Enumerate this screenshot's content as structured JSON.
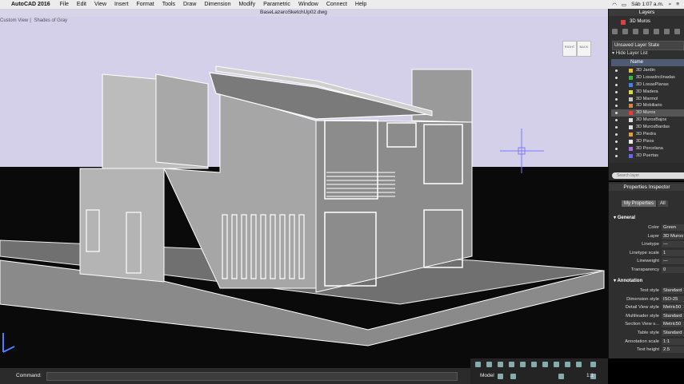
{
  "menubar": {
    "app_name": "AutoCAD 2016",
    "items": [
      "File",
      "Edit",
      "View",
      "Insert",
      "Format",
      "Tools",
      "Draw",
      "Dimension",
      "Modify",
      "Parametric",
      "Window",
      "Connect",
      "Help"
    ],
    "clock": "Sáb 1:07 a.m."
  },
  "document": {
    "title": "BaseLazaroSketchUp02.dwg"
  },
  "viewport": {
    "view_name": "Custom View",
    "visual_style": "Shades of Gray",
    "sky_color": "#d4d0ea",
    "ground_color": "#0a0a0a"
  },
  "viewcube": {
    "left_face": "RIGHT",
    "right_face": "BACK"
  },
  "command": {
    "label": "Command:",
    "value": ""
  },
  "statusbar": {
    "model_label": "Model",
    "scale": "1:1"
  },
  "layers_panel": {
    "title": "Layers",
    "current_layer": "3D Muros",
    "state_select": "Unsaved Layer State",
    "hide_list_label": "Hide Layer List",
    "column_name": "Name",
    "search_placeholder": "Search layer",
    "rows": [
      {
        "name": "3D Jardin",
        "color": "#d8c04a",
        "selected": false
      },
      {
        "name": "3D LosasInclinadas",
        "color": "#3fb24a",
        "selected": false
      },
      {
        "name": "3D LosasPlanas",
        "color": "#4a7fd8",
        "selected": false
      },
      {
        "name": "3D Madera",
        "color": "#d8d84a",
        "selected": false
      },
      {
        "name": "3D Marmol",
        "color": "#c8c8c8",
        "selected": false
      },
      {
        "name": "3D Mobiliario",
        "color": "#c88a4a",
        "selected": false
      },
      {
        "name": "3D Muros",
        "color": "#e04040",
        "selected": true
      },
      {
        "name": "3D MurosBajos",
        "color": "#dddddd",
        "selected": false
      },
      {
        "name": "3D MurosBardas",
        "color": "#dddddd",
        "selected": false
      },
      {
        "name": "3D Piedra",
        "color": "#d8a04a",
        "selected": false
      },
      {
        "name": "3D Pisos",
        "color": "#e8e8e8",
        "selected": false
      },
      {
        "name": "3D Porcelana",
        "color": "#a070d8",
        "selected": false
      },
      {
        "name": "3D Puertas",
        "color": "#6a6ad8",
        "selected": false
      }
    ]
  },
  "properties_panel": {
    "title": "Properties Inspector",
    "tabs": [
      "My Properties",
      "All"
    ],
    "general_label": "General",
    "general": [
      {
        "key": "Color",
        "value": "Green"
      },
      {
        "key": "Layer",
        "value": "3D Muros"
      },
      {
        "key": "Linetype",
        "value": "—"
      },
      {
        "key": "Linetype scale",
        "value": "1"
      },
      {
        "key": "Lineweight",
        "value": "—"
      },
      {
        "key": "Transparency",
        "value": "0"
      }
    ],
    "annotation_label": "Annotation",
    "annotation": [
      {
        "key": "Text style",
        "value": "Standard"
      },
      {
        "key": "Dimension style",
        "value": "ISO-25"
      },
      {
        "key": "Detail View style",
        "value": "Metric50"
      },
      {
        "key": "Multileader style",
        "value": "Standard"
      },
      {
        "key": "Section View s...",
        "value": "Metric50"
      },
      {
        "key": "Table style",
        "value": "Standard"
      },
      {
        "key": "Annotation scale",
        "value": "1:1"
      },
      {
        "key": "Text height",
        "value": "2.5"
      }
    ]
  }
}
